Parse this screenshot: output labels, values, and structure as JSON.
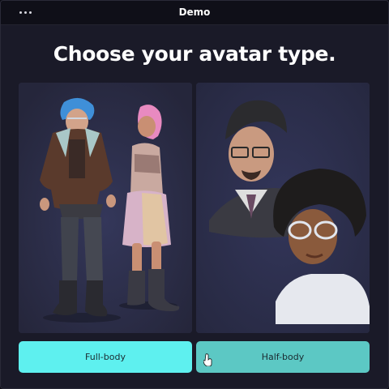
{
  "titlebar": {
    "title": "Demo",
    "menu_icon": "more-horizontal-icon"
  },
  "main": {
    "heading": "Choose your avatar type.",
    "options": [
      {
        "id": "full-body",
        "label": "Full-body",
        "image": "full-body-avatars-image"
      },
      {
        "id": "half-body",
        "label": "Half-body",
        "image": "half-body-avatars-image"
      }
    ]
  },
  "colors": {
    "background": "#1a1a28",
    "card": "#2b2d44",
    "button_primary": "#5ef0ef",
    "button_secondary": "#5cc8c4"
  }
}
